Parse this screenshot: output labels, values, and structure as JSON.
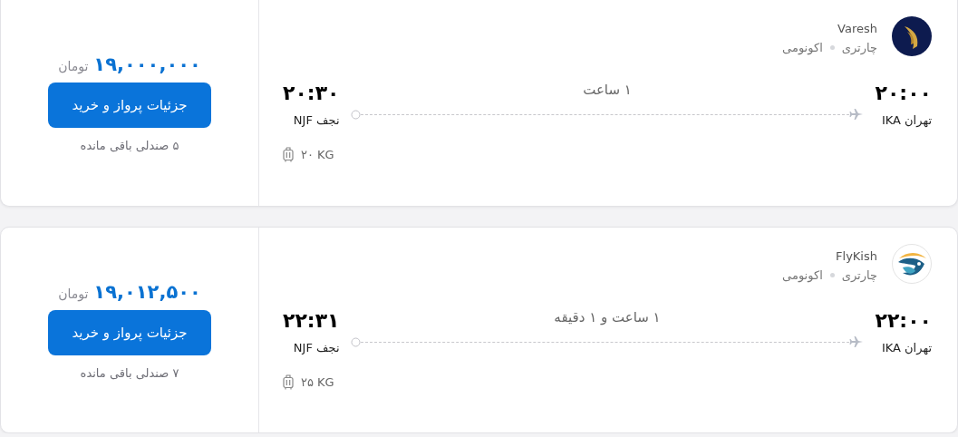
{
  "flights": [
    {
      "airline": {
        "name": "Varesh",
        "fare_type": "چارتری",
        "cabin": "اکونومی"
      },
      "departure": {
        "time": "۲۰:۰۰",
        "airport": "تهران IKA"
      },
      "arrival": {
        "time": "۲۰:۳۰",
        "airport": "نجف NJF"
      },
      "duration": "۱ ساعت",
      "baggage": "۲۰ KG",
      "price": "۱۹,۰۰۰,۰۰۰",
      "currency": "تومان",
      "button": "جزئیات پرواز و خرید",
      "seats_left": "۵ صندلی باقی مانده"
    },
    {
      "airline": {
        "name": "FlyKish",
        "fare_type": "چارتری",
        "cabin": "اکونومی"
      },
      "departure": {
        "time": "۲۲:۰۰",
        "airport": "تهران IKA"
      },
      "arrival": {
        "time": "۲۲:۳۱",
        "airport": "نجف NJF"
      },
      "duration": "۱ ساعت و ۱ دقیقه",
      "baggage": "۲۵ KG",
      "price": "۱۹,۰۱۲,۵۰۰",
      "currency": "تومان",
      "button": "جزئیات پرواز و خرید",
      "seats_left": "۷ صندلی باقی مانده"
    }
  ]
}
